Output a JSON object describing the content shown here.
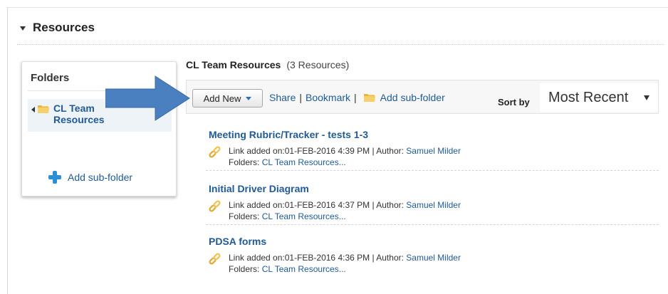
{
  "section": {
    "title": "Resources"
  },
  "folders": {
    "title": "Folders",
    "item_label": "CL Team Resources",
    "add_label": "Add sub-folder"
  },
  "content": {
    "title": "CL Team Resources",
    "count": "(3 Resources)"
  },
  "toolbar": {
    "add_new": "Add New",
    "share": "Share",
    "bookmark": "Bookmark",
    "add_subfolder": "Add sub-folder",
    "sort_by": "Sort by",
    "sort_value": "Most Recent"
  },
  "resources": [
    {
      "title": "Meeting Rubric/Tracker - tests 1-3",
      "meta": "Link added on:01-FEB-2016 4:39 PM | Author: ",
      "author": "Samuel Milder",
      "folders_prefix": "Folders: ",
      "folders_value": "CL Team Resources..."
    },
    {
      "title": "Initial Driver Diagram",
      "meta": "Link added on:01-FEB-2016 4:37 PM | Author: ",
      "author": "Samuel Milder",
      "folders_prefix": "Folders: ",
      "folders_value": "CL Team Resources..."
    },
    {
      "title": "PDSA forms",
      "meta": "Link added on:01-FEB-2016 4:36 PM | Author: ",
      "author": "Samuel Milder",
      "folders_prefix": "Folders: ",
      "folders_value": "CL Team Resources..."
    }
  ],
  "colors": {
    "link": "#1f5a96",
    "arrow": "#4a7fc0",
    "folder": "#f2c14e"
  }
}
